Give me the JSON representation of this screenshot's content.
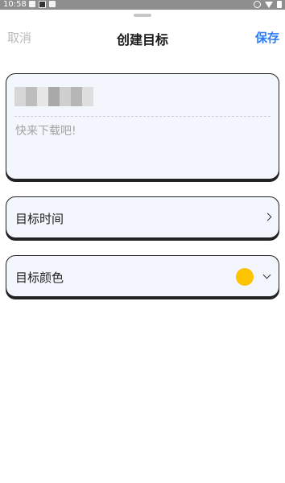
{
  "status_bar": {
    "time": "10:58"
  },
  "header": {
    "cancel_label": "取消",
    "title": "创建目标",
    "save_label": "保存"
  },
  "goal_form": {
    "name_value_redacted": true,
    "description_placeholder": "快来下载吧!"
  },
  "rows": {
    "time_label": "目标时间",
    "color_label": "目标颜色"
  },
  "colors": {
    "accent": "#2f7df6",
    "selected_goal_color": "#ffc400",
    "card_bg": "#f3f6fc",
    "mosaic": [
      "#d7d7d7",
      "#bdbdbd",
      "#e6e6e6",
      "#a9a9a9",
      "#cfcfcf",
      "#b6b6b6",
      "#dedede"
    ]
  },
  "icons": {
    "time_chevron": "chevron-right-icon",
    "color_chevron": "chevron-down-icon"
  }
}
